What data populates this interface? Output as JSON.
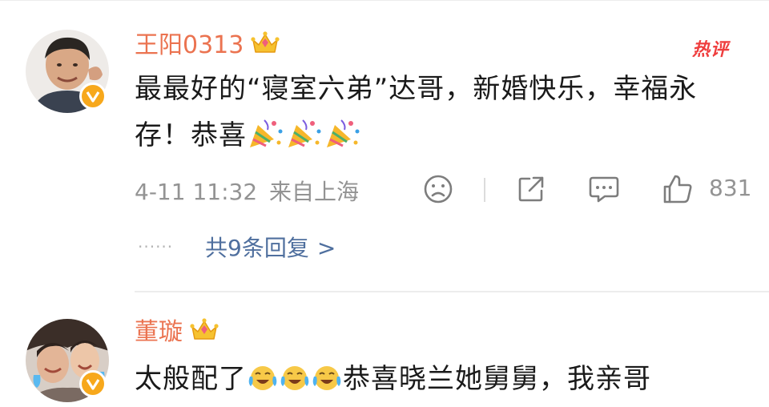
{
  "comments": [
    {
      "username": "王阳0313",
      "tag": "热评",
      "text": "最最好的“寝室六弟”达哥，新婚快乐，幸福永存！恭喜",
      "emojis": [
        "party-popper",
        "party-popper",
        "party-popper"
      ],
      "timestamp": "4-11 11:32",
      "location": "来自上海",
      "likes": "831",
      "replies_label": "共9条回复",
      "replies_dots": "······",
      "replies_chevron": ">"
    },
    {
      "username": "董璇",
      "text": "太般配了",
      "emojis": [
        "laugh-cry",
        "laugh-cry",
        "laugh-cry"
      ],
      "text_after": "恭喜晓兰她舅舅，我亲哥"
    }
  ],
  "colors": {
    "username": "#eb7350",
    "replies_link": "#4f6f9e",
    "meta": "#939393",
    "hot_tag": "#ef3e3e",
    "verified_badge": "#f7a81c"
  },
  "icons": [
    "crown-icon",
    "verified-v-icon",
    "dislike-face-icon",
    "share-icon",
    "comment-icon",
    "like-thumb-icon"
  ]
}
